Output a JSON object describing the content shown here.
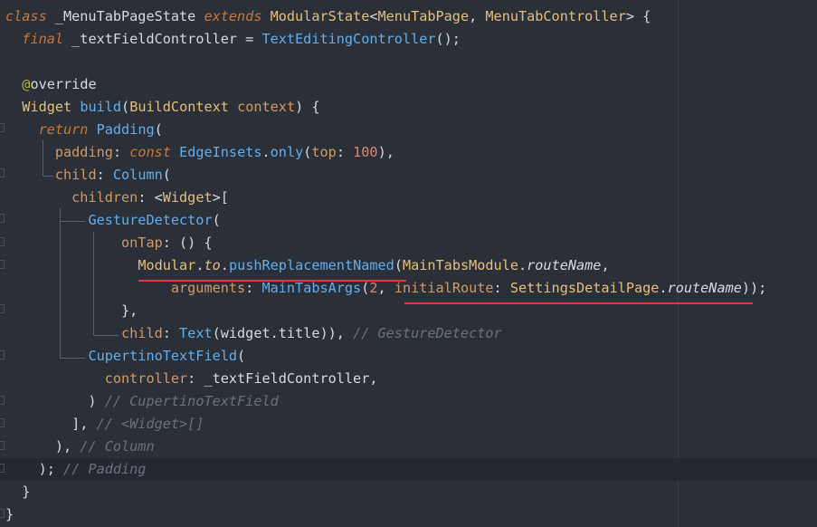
{
  "code_lines": [
    {
      "tokens": [
        {
          "t": "class",
          "c": "k"
        },
        {
          "t": " _MenuTabPageState ",
          "c": "plain"
        },
        {
          "t": "extends",
          "c": "k"
        },
        {
          "t": " ",
          "c": "plain"
        },
        {
          "t": "ModularState",
          "c": "cls"
        },
        {
          "t": "<",
          "c": "plain"
        },
        {
          "t": "MenuTabPage",
          "c": "cls"
        },
        {
          "t": ", ",
          "c": "plain"
        },
        {
          "t": "MenuTabController",
          "c": "cls"
        },
        {
          "t": "> {",
          "c": "plain"
        }
      ]
    },
    {
      "tokens": [
        {
          "t": "  ",
          "c": "plain"
        },
        {
          "t": "final",
          "c": "k"
        },
        {
          "t": " _textFieldController = ",
          "c": "plain"
        },
        {
          "t": "TextEditingController",
          "c": "fn"
        },
        {
          "t": "();",
          "c": "plain"
        }
      ]
    },
    {
      "tokens": []
    },
    {
      "tokens": [
        {
          "t": "  ",
          "c": "plain"
        },
        {
          "t": "@",
          "c": "ann"
        },
        {
          "t": "override",
          "c": "plain"
        }
      ]
    },
    {
      "tokens": [
        {
          "t": "  ",
          "c": "plain"
        },
        {
          "t": "Widget",
          "c": "cls"
        },
        {
          "t": " ",
          "c": "plain"
        },
        {
          "t": "build",
          "c": "fn"
        },
        {
          "t": "(",
          "c": "plain"
        },
        {
          "t": "BuildContext",
          "c": "cls"
        },
        {
          "t": " ",
          "c": "plain"
        },
        {
          "t": "context",
          "c": "prm"
        },
        {
          "t": ") {",
          "c": "plain"
        }
      ]
    },
    {
      "tokens": [
        {
          "t": "    ",
          "c": "plain"
        },
        {
          "t": "return",
          "c": "k"
        },
        {
          "t": " ",
          "c": "plain"
        },
        {
          "t": "Padding",
          "c": "fn"
        },
        {
          "t": "(",
          "c": "plain"
        }
      ]
    },
    {
      "tokens": [
        {
          "t": "      ",
          "c": "plain"
        },
        {
          "t": "padding",
          "c": "prm"
        },
        {
          "t": ": ",
          "c": "plain"
        },
        {
          "t": "const",
          "c": "k"
        },
        {
          "t": " ",
          "c": "plain"
        },
        {
          "t": "EdgeInsets",
          "c": "fn"
        },
        {
          "t": ".",
          "c": "plain"
        },
        {
          "t": "only",
          "c": "fn"
        },
        {
          "t": "(",
          "c": "plain"
        },
        {
          "t": "top",
          "c": "prm"
        },
        {
          "t": ": ",
          "c": "plain"
        },
        {
          "t": "100",
          "c": "num"
        },
        {
          "t": "),",
          "c": "plain"
        }
      ]
    },
    {
      "tokens": [
        {
          "t": "      ",
          "c": "plain"
        },
        {
          "t": "child",
          "c": "prm"
        },
        {
          "t": ": ",
          "c": "plain"
        },
        {
          "t": "Column",
          "c": "fn"
        },
        {
          "t": "(",
          "c": "plain"
        }
      ]
    },
    {
      "tokens": [
        {
          "t": "        ",
          "c": "plain"
        },
        {
          "t": "children",
          "c": "prm"
        },
        {
          "t": ": <",
          "c": "plain"
        },
        {
          "t": "Widget",
          "c": "cls"
        },
        {
          "t": ">[",
          "c": "plain"
        }
      ]
    },
    {
      "tokens": [
        {
          "t": "          ",
          "c": "plain"
        },
        {
          "t": "GestureDetector",
          "c": "fn"
        },
        {
          "t": "(",
          "c": "plain"
        }
      ]
    },
    {
      "tokens": [
        {
          "t": "              ",
          "c": "plain"
        },
        {
          "t": "onTap",
          "c": "prm"
        },
        {
          "t": ": () {",
          "c": "plain"
        }
      ]
    },
    {
      "tokens": [
        {
          "t": "                ",
          "c": "plain"
        },
        {
          "t": "Modular",
          "c": "cls"
        },
        {
          "t": ".",
          "c": "plain"
        },
        {
          "t": "to",
          "c": "cls ital"
        },
        {
          "t": ".",
          "c": "plain"
        },
        {
          "t": "pushReplacementNamed",
          "c": "fn"
        },
        {
          "t": "(",
          "c": "plain"
        },
        {
          "t": "MainTabsModule",
          "c": "cls"
        },
        {
          "t": ".",
          "c": "plain"
        },
        {
          "t": "routeName",
          "c": "plain ital"
        },
        {
          "t": ",",
          "c": "plain"
        }
      ]
    },
    {
      "tokens": [
        {
          "t": "                    ",
          "c": "plain"
        },
        {
          "t": "arguments",
          "c": "prm"
        },
        {
          "t": ": ",
          "c": "plain"
        },
        {
          "t": "MainTabsArgs",
          "c": "fn"
        },
        {
          "t": "(",
          "c": "plain"
        },
        {
          "t": "2",
          "c": "num"
        },
        {
          "t": ", ",
          "c": "plain"
        },
        {
          "t": "initialRoute",
          "c": "prm"
        },
        {
          "t": ": ",
          "c": "plain"
        },
        {
          "t": "SettingsDetailPage",
          "c": "cls"
        },
        {
          "t": ".",
          "c": "plain"
        },
        {
          "t": "routeName",
          "c": "plain ital"
        },
        {
          "t": "));",
          "c": "plain"
        }
      ]
    },
    {
      "tokens": [
        {
          "t": "              },",
          "c": "plain"
        }
      ]
    },
    {
      "tokens": [
        {
          "t": "              ",
          "c": "plain"
        },
        {
          "t": "child",
          "c": "prm"
        },
        {
          "t": ": ",
          "c": "plain"
        },
        {
          "t": "Text",
          "c": "fn"
        },
        {
          "t": "(widget.title)), ",
          "c": "plain"
        },
        {
          "t": "// GestureDetector",
          "c": "cmt"
        }
      ]
    },
    {
      "tokens": [
        {
          "t": "          ",
          "c": "plain"
        },
        {
          "t": "CupertinoTextField",
          "c": "fn"
        },
        {
          "t": "(",
          "c": "plain"
        }
      ]
    },
    {
      "tokens": [
        {
          "t": "            ",
          "c": "plain"
        },
        {
          "t": "controller",
          "c": "prm"
        },
        {
          "t": ": _textFieldController,",
          "c": "plain"
        }
      ]
    },
    {
      "tokens": [
        {
          "t": "          ) ",
          "c": "plain"
        },
        {
          "t": "// CupertinoTextField",
          "c": "cmt"
        }
      ]
    },
    {
      "tokens": [
        {
          "t": "        ], ",
          "c": "plain"
        },
        {
          "t": "// <Widget>[]",
          "c": "cmt"
        }
      ]
    },
    {
      "tokens": [
        {
          "t": "      ), ",
          "c": "plain"
        },
        {
          "t": "// Column",
          "c": "cmt"
        }
      ]
    },
    {
      "tokens": [
        {
          "t": "    ); ",
          "c": "plain"
        },
        {
          "t": "// Padding",
          "c": "cmt"
        }
      ]
    },
    {
      "tokens": [
        {
          "t": "  }",
          "c": "plain"
        }
      ]
    },
    {
      "tokens": [
        {
          "t": "}",
          "c": "plain"
        }
      ]
    }
  ],
  "current_line": 20
}
